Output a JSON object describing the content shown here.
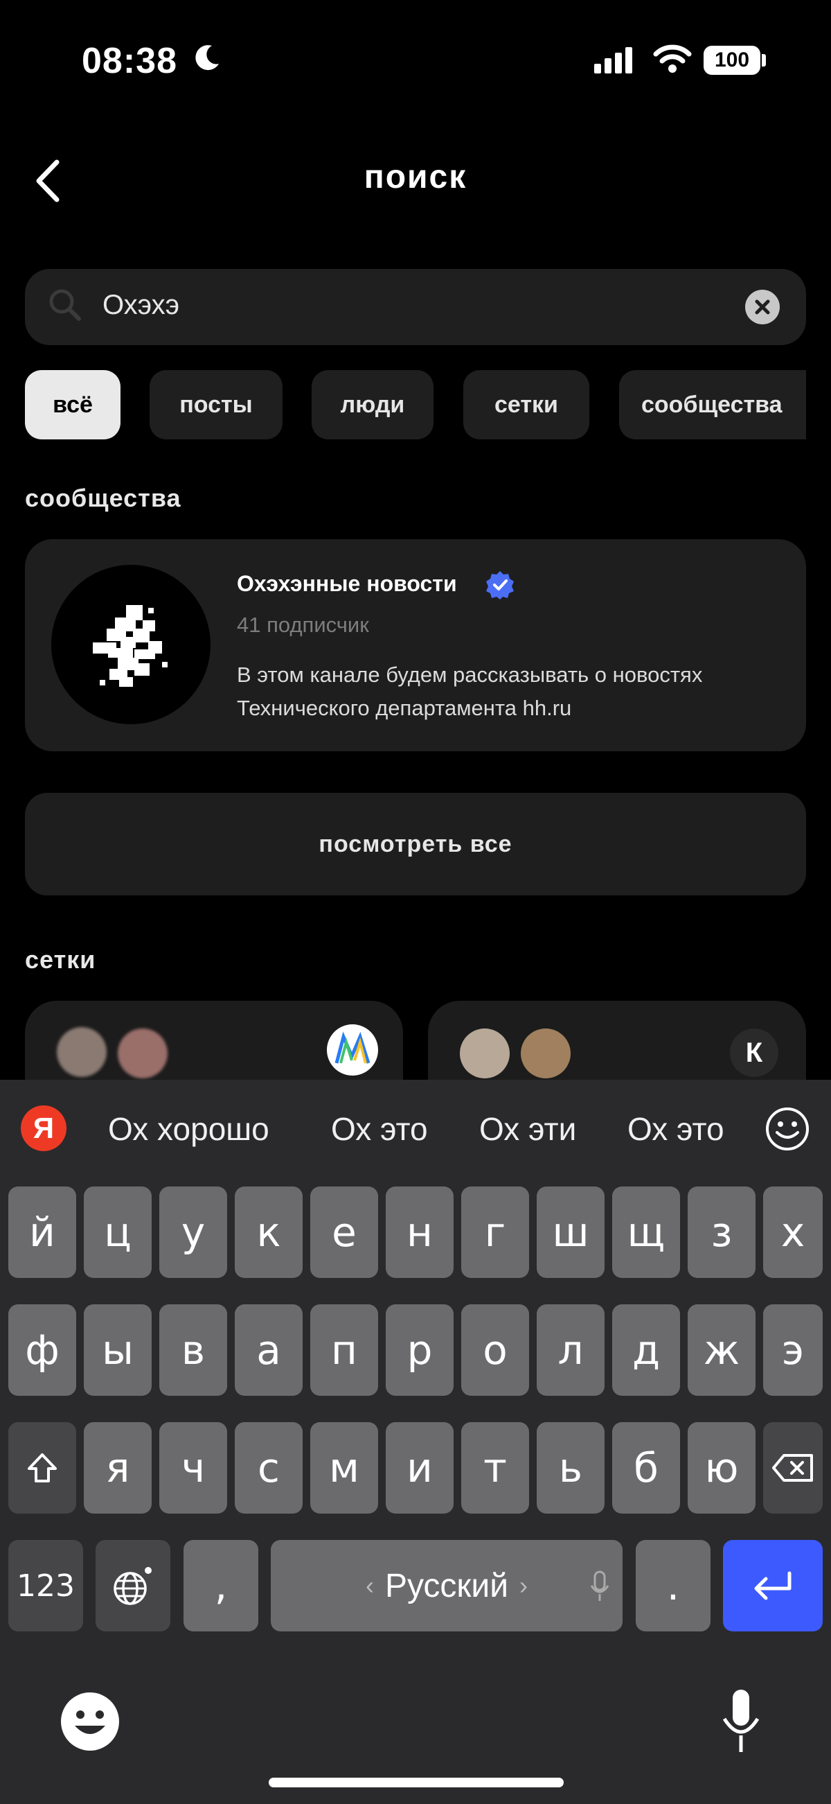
{
  "status_bar": {
    "time": "08:38",
    "battery": "100"
  },
  "header": {
    "title": "поиск"
  },
  "search": {
    "query": "Охэхэ"
  },
  "filters": [
    "всё",
    "посты",
    "люди",
    "сетки",
    "сообщества"
  ],
  "sections": {
    "communities": "сообщества",
    "networks": "сетки"
  },
  "community": {
    "name": "Охэхэнные новости",
    "subscribers": "41 подписчик",
    "description": "В этом канале будем рассказывать о новостях Технического департамента hh.ru"
  },
  "see_all": "посмотреть все",
  "network_badge": "К",
  "keyboard": {
    "logo": "Я",
    "suggestions": [
      "Ох хорошо",
      "Ох это",
      "Ох эти",
      "Ох это"
    ],
    "row1": [
      "й",
      "ц",
      "у",
      "к",
      "е",
      "н",
      "г",
      "ш",
      "щ",
      "з",
      "х"
    ],
    "row2": [
      "ф",
      "ы",
      "в",
      "а",
      "п",
      "р",
      "о",
      "л",
      "д",
      "ж",
      "э"
    ],
    "row3": [
      "я",
      "ч",
      "с",
      "м",
      "и",
      "т",
      "ь",
      "б",
      "ю"
    ],
    "numbers": "123",
    "comma": ",",
    "space": "Русский",
    "period": "."
  },
  "colors": {
    "accent_blue": "#3d5afe",
    "verified": "#4c6ef5",
    "yandex": "#ee3a24"
  }
}
